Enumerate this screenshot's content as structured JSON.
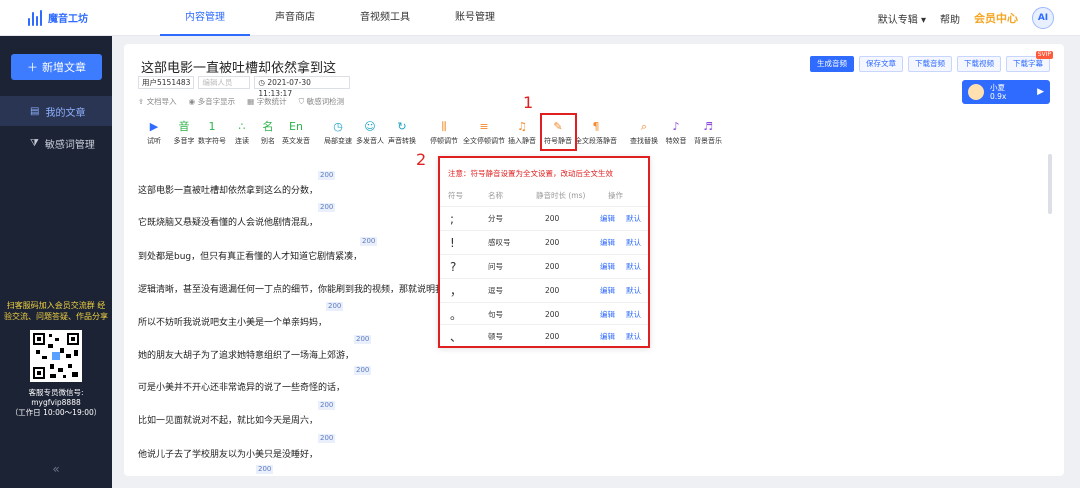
{
  "app": {
    "name": "魔音工坊"
  },
  "nav": [
    "内容管理",
    "声音商店",
    "音视频工具",
    "账号管理"
  ],
  "top_right": {
    "album": "默认专辑 ▾",
    "help": "帮助",
    "vip": "会员中心",
    "avatar": "AI"
  },
  "sidebar": {
    "new_button": "新增文章",
    "items": [
      {
        "label": "我的文章"
      },
      {
        "label": "敏感词管理"
      }
    ],
    "qr_title": "扫客服码加入会员交流群 经验交流、问题答疑、作品分享",
    "qr_info_1": "客服专员微信号:",
    "qr_info_2": "mygfvip8888",
    "qr_info_3": "（工作日 10:00～19:00）",
    "collapse": "«"
  },
  "doc": {
    "title": "这部电影一直被吐槽却依然拿到这",
    "user": "用户5151483",
    "author_placeholder": "编辑人员",
    "date": "2021-07-30 11:13:17",
    "options": [
      "文档导入",
      "多音字显示",
      "字数统计",
      "敏感词检测"
    ]
  },
  "actions": {
    "generate": "生成音频",
    "save": "保存文章",
    "dl_audio": "下载音频",
    "dl_video": "下载视频",
    "dl_sub": "下载字幕",
    "svip": "SVIP"
  },
  "voice": {
    "name": "小夏",
    "speed": "0.9x",
    "play": "▶"
  },
  "tools": [
    {
      "label": "试听",
      "icon": "▶"
    },
    {
      "label": "多音字",
      "icon": "音"
    },
    {
      "label": "数字符号",
      "icon": "1"
    },
    {
      "label": "连读",
      "icon": "∴"
    },
    {
      "label": "别名",
      "icon": "名"
    },
    {
      "label": "英文发音",
      "icon": "En"
    },
    {
      "label": "局部变速",
      "icon": "◷"
    },
    {
      "label": "多发音人",
      "icon": "☺"
    },
    {
      "label": "声音转换",
      "icon": "↻"
    },
    {
      "label": "停顿调节",
      "icon": "⫼"
    },
    {
      "label": "全文停顿调节",
      "icon": "≡"
    },
    {
      "label": "插入静音",
      "icon": "♫"
    },
    {
      "label": "符号静音",
      "icon": "✎"
    },
    {
      "label": "全文段落静音",
      "icon": "¶"
    },
    {
      "label": "查找替换",
      "icon": "⌕"
    },
    {
      "label": "特效音",
      "icon": "♪"
    },
    {
      "label": "背景音乐",
      "icon": "♬"
    }
  ],
  "annotations": {
    "n1": "1",
    "n2": "2"
  },
  "text_lines": [
    {
      "text": "这部电影一直被吐槽却依然拿到这么的分数，",
      "pause": "200"
    },
    {
      "text": "它既烧脑又悬疑没看懂的人会说他剧情混乱，",
      "pause": "200"
    },
    {
      "text": "到处都是bug，但只有真正看懂的人才知道它剧情紧凑，",
      "pause": "200"
    },
    {
      "text": "逻辑清晰，甚至没有遗漏任何一丁点的细节，你能刷到我的视频，那就说明我",
      "pause": ""
    },
    {
      "text": "所以不妨听我说说吧女主小美是一个单亲妈妈，",
      "pause": "200"
    },
    {
      "text": "她的朋友大胡子为了追求她特意组织了一场海上郊游，",
      "pause": "200"
    },
    {
      "text": "可是小美并不开心还非常诡异的说了一些奇怪的话，",
      "pause": "200"
    },
    {
      "text": "比如一见面就说对不起，就比如今天是周六，",
      "pause": "200"
    },
    {
      "text": "他说儿子去了学校朋友以为小美只是没睡好，",
      "pause": "200"
    },
    {
      "text": "",
      "pause": "200"
    }
  ],
  "popup": {
    "note": "注意：符号静音设置为全文设置，改动后全文生效",
    "headers": [
      "符号",
      "名称",
      "静音时长 (ms)",
      "操作"
    ],
    "rows": [
      {
        "sym": ";",
        "name": "分号",
        "dur": "200",
        "edit": "编辑",
        "default": "默认"
      },
      {
        "sym": "!",
        "name": "感叹号",
        "dur": "200",
        "edit": "编辑",
        "default": "默认"
      },
      {
        "sym": "?",
        "name": "问号",
        "dur": "200",
        "edit": "编辑",
        "default": "默认"
      },
      {
        "sym": "，",
        "name": "逗号",
        "dur": "200",
        "edit": "编辑",
        "default": "默认"
      },
      {
        "sym": "。",
        "name": "句号",
        "dur": "200",
        "edit": "编辑",
        "default": "默认"
      },
      {
        "sym": "、",
        "name": "顿号",
        "dur": "200",
        "edit": "编辑",
        "default": "默认"
      }
    ]
  }
}
